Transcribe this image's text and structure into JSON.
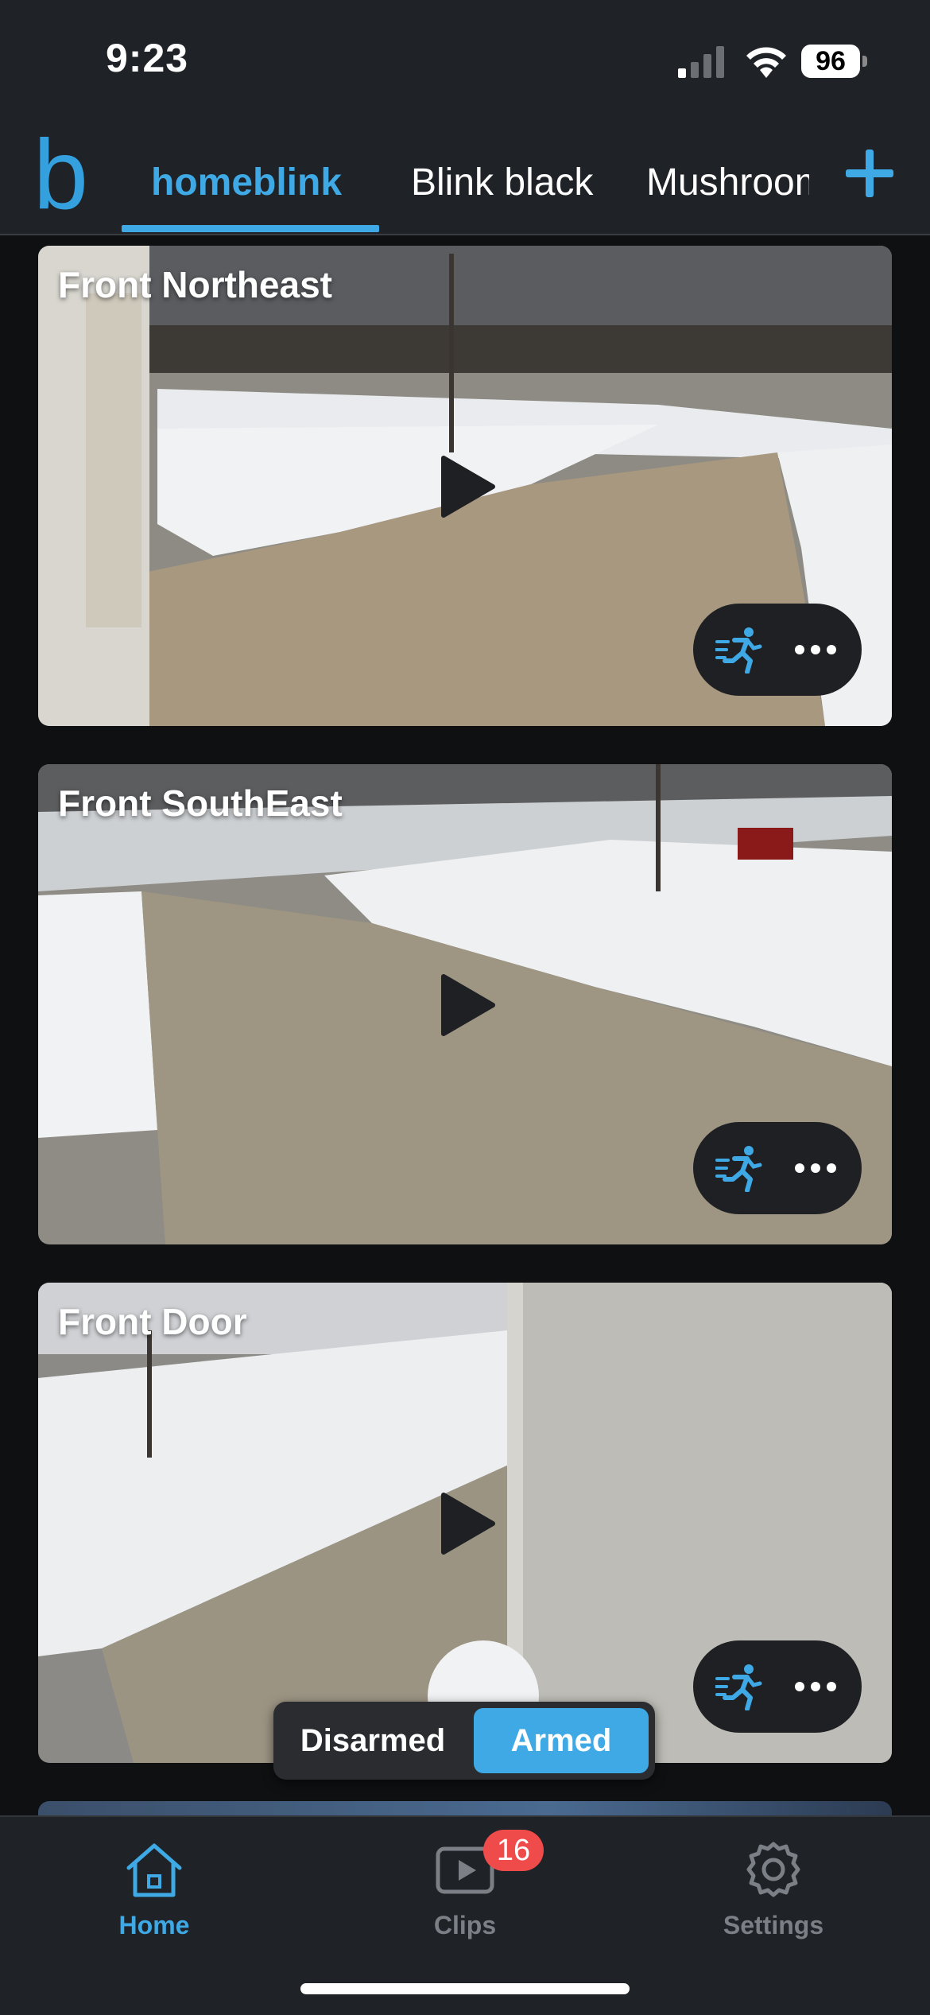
{
  "status_bar": {
    "time": "9:23",
    "battery_percent": "96",
    "signal_bars_active": 1,
    "signal_bars_total": 4
  },
  "header": {
    "logo_text": "b",
    "tabs": [
      {
        "label": "homeblink",
        "active": true
      },
      {
        "label": "Blink black",
        "active": false
      },
      {
        "label": "Mushroom",
        "active": false
      }
    ],
    "add_icon": "plus-icon"
  },
  "cameras": [
    {
      "name": "Front Northeast",
      "motion_icon": "running-person-icon",
      "more_icon": "ellipsis-icon"
    },
    {
      "name": "Front SouthEast",
      "motion_icon": "running-person-icon",
      "more_icon": "ellipsis-icon"
    },
    {
      "name": "Front Door",
      "motion_icon": "running-person-icon",
      "more_icon": "ellipsis-icon"
    }
  ],
  "arm_toggle": {
    "disarmed_label": "Disarmed",
    "armed_label": "Armed",
    "selected": "Armed"
  },
  "bottom_nav": {
    "items": [
      {
        "label": "Home",
        "icon": "house-icon",
        "active": true
      },
      {
        "label": "Clips",
        "icon": "play-video-icon",
        "badge": "16",
        "active": false
      },
      {
        "label": "Settings",
        "icon": "gear-icon",
        "active": false
      }
    ]
  },
  "colors": {
    "accent": "#3fa9e5",
    "background": "#0f1012",
    "bar": "#1f2226",
    "badge": "#ef4b4b",
    "inactive": "#7b7f86"
  }
}
